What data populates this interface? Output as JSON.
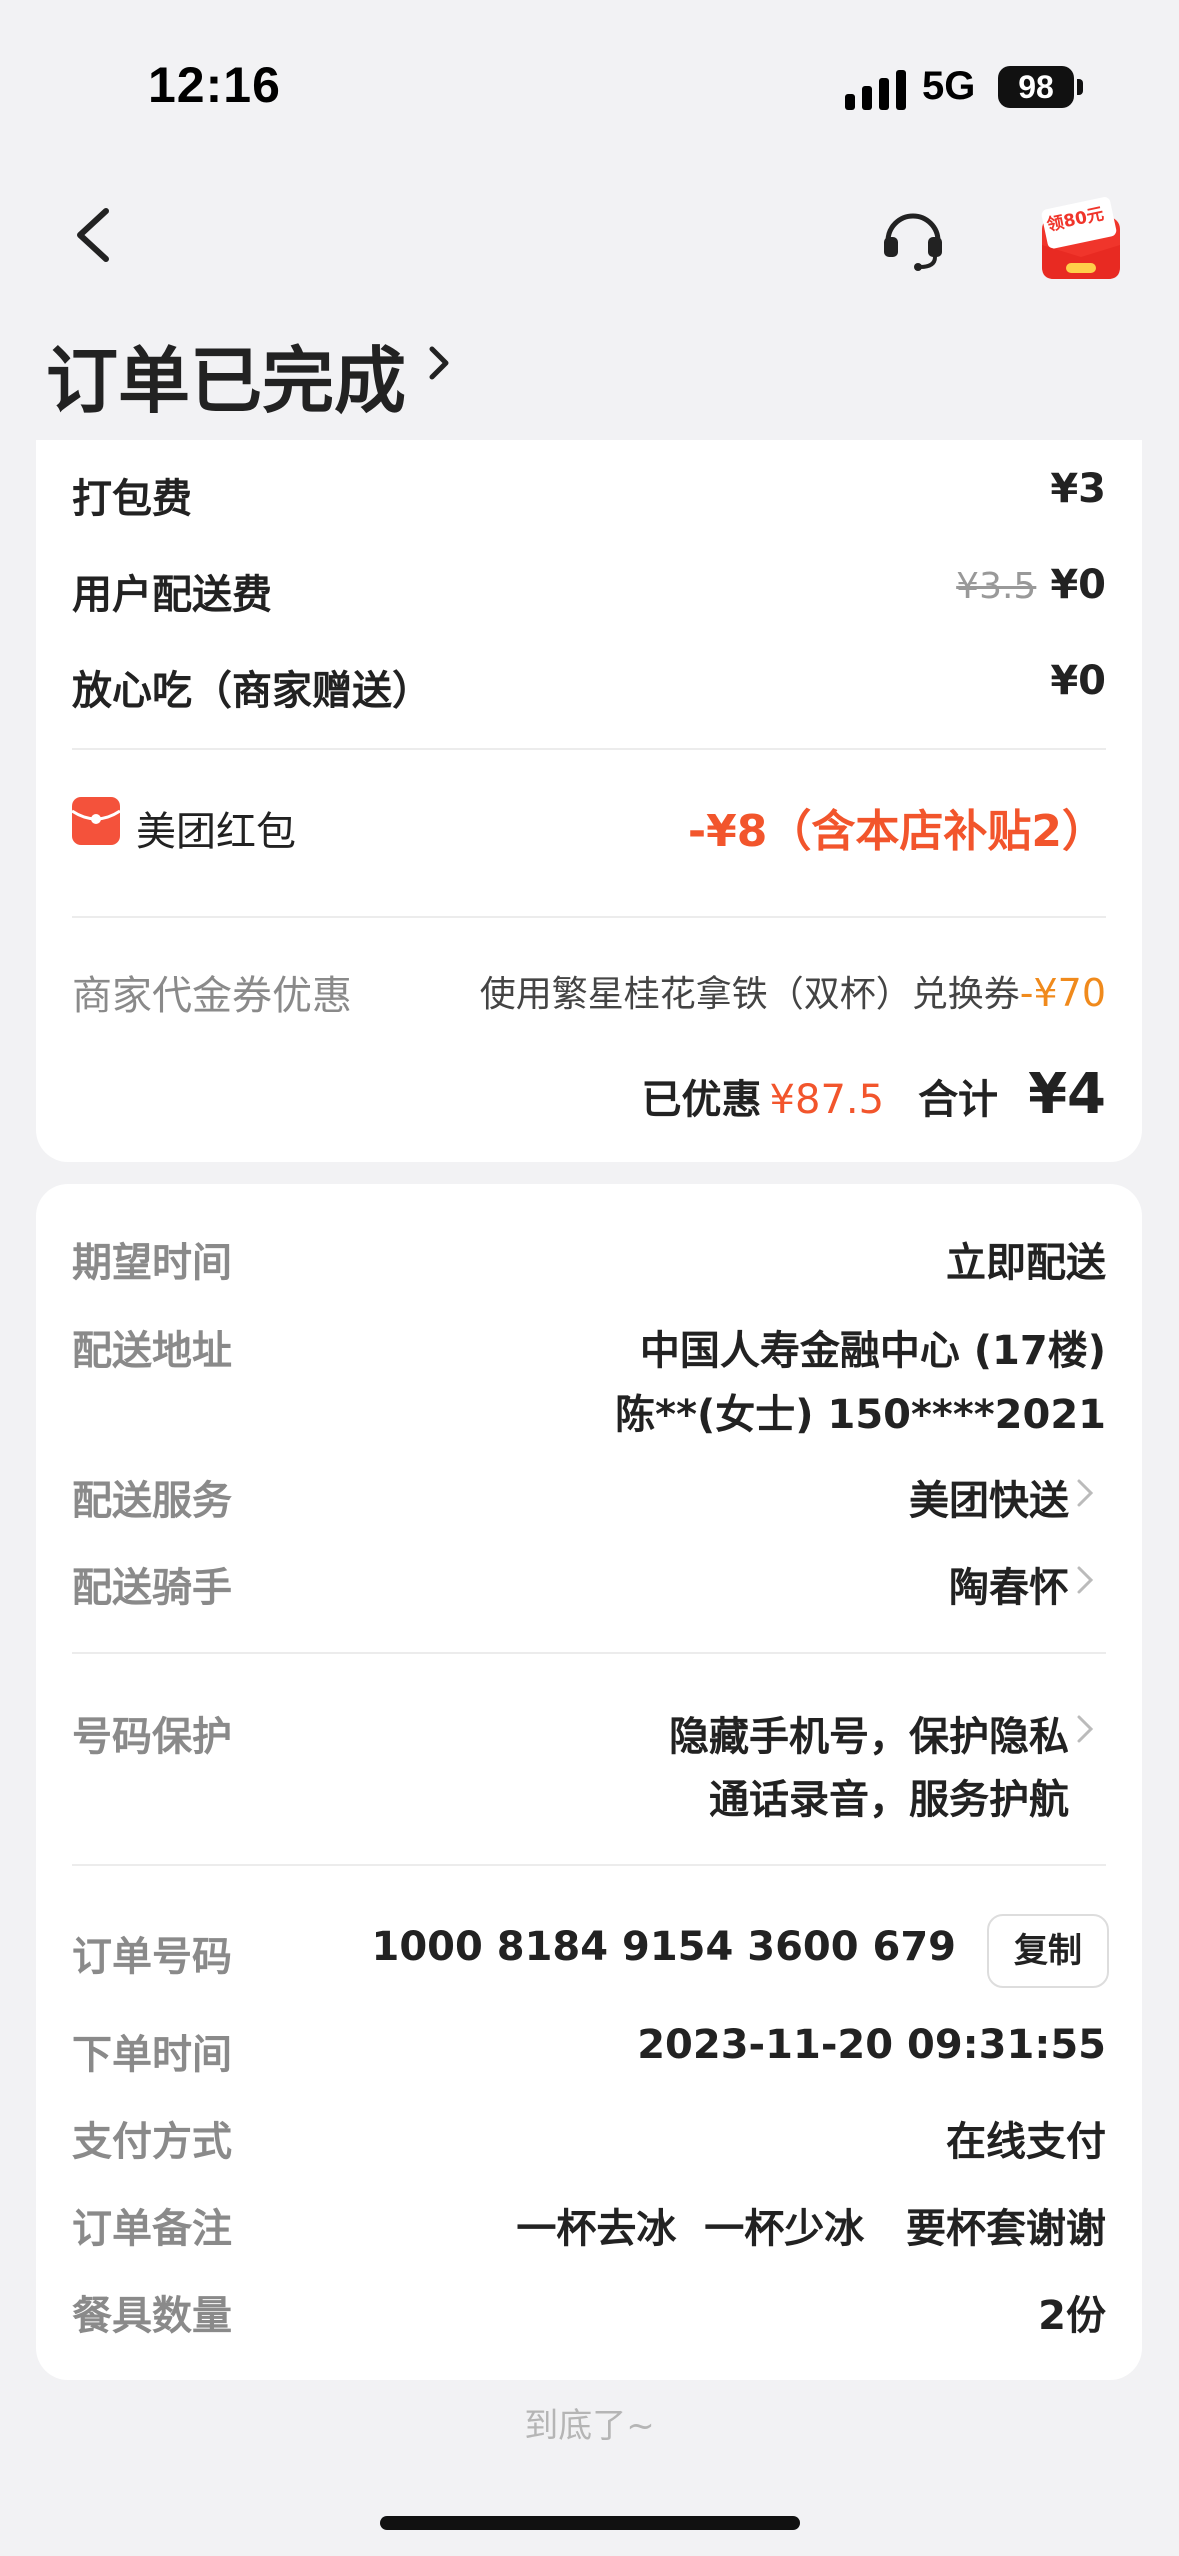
{
  "status_bar": {
    "time": "12:16",
    "network": "5G",
    "battery": "98"
  },
  "header": {
    "title": "订单已完成",
    "promo_badge_text": "领80元"
  },
  "fees": {
    "packing": {
      "label": "打包费",
      "value": "¥3"
    },
    "delivery": {
      "label": "用户配送费",
      "original": "¥3.5",
      "value": "¥0"
    },
    "assurance": {
      "label": "放心吃（商家赠送）",
      "value": "¥0"
    }
  },
  "red_packet": {
    "label": "美团红包",
    "value": "-¥8（含本店补贴2）"
  },
  "voucher": {
    "label": "商家代金券优惠",
    "desc": "使用繁星桂花拿铁（双杯）兑换券",
    "value": "-¥70"
  },
  "summary": {
    "discount_label": "已优惠",
    "discount_value": "¥87.5",
    "total_label": "合计",
    "total_value": "¥4"
  },
  "delivery_info": {
    "expected_time": {
      "label": "期望时间",
      "value": "立即配送"
    },
    "address": {
      "label": "配送地址",
      "line1": "中国人寿金融中心 (17楼)",
      "line2": "陈**(女士) 150****2021"
    },
    "service": {
      "label": "配送服务",
      "value": "美团快送"
    },
    "rider": {
      "label": "配送骑手",
      "value": "陶春怀"
    }
  },
  "privacy": {
    "label": "号码保护",
    "line1": "隐藏手机号，保护隐私",
    "line2": "通话录音，服务护航"
  },
  "order": {
    "number": {
      "label": "订单号码",
      "value": "1000 8184 9154 3600 679",
      "copy": "复制"
    },
    "time": {
      "label": "下单时间",
      "value": "2023-11-20 09:31:55"
    },
    "payment": {
      "label": "支付方式",
      "value": "在线支付"
    },
    "note": {
      "label": "订单备注",
      "value": "一杯去冰  一杯少冰   要杯套谢谢"
    },
    "utensils": {
      "label": "餐具数量",
      "value": "2份"
    }
  },
  "footer": "到底了~",
  "colors": {
    "accent_red": "#f2552c",
    "voucher_orange": "#f08a1c",
    "page_bg": "#f2f2f4"
  }
}
